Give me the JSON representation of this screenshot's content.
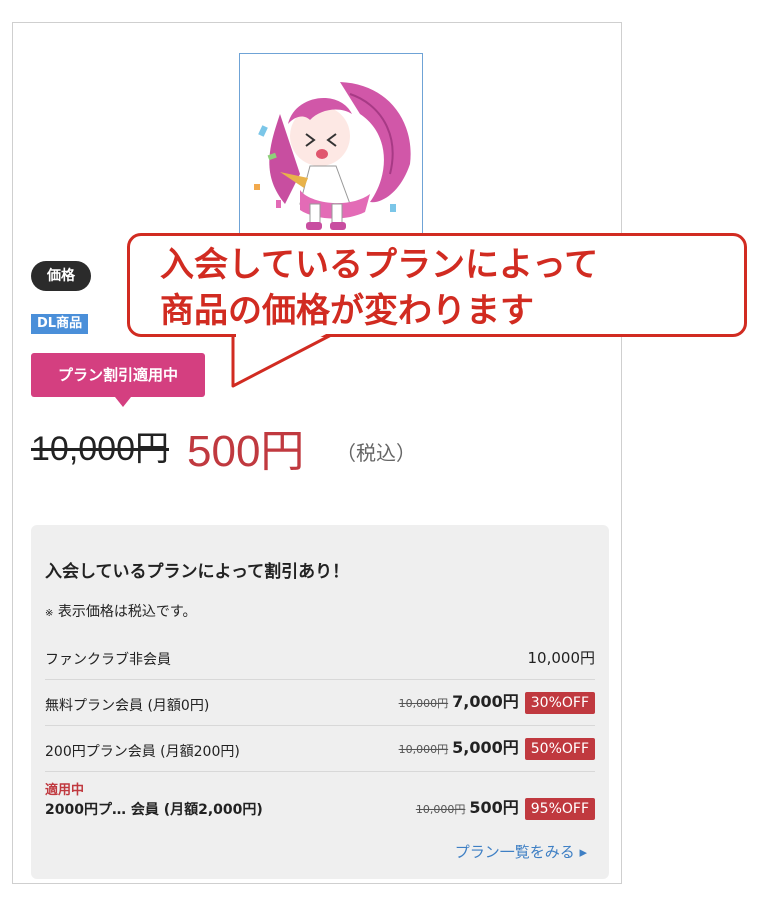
{
  "badges": {
    "price": "価格",
    "dl": "DL商品"
  },
  "plan_ribbon": "プラン割引適用中",
  "price": {
    "original": "10,000円",
    "discounted": "500円",
    "tax_note": "（税込）"
  },
  "callout": {
    "line1": "入会しているプランによって",
    "line2": "商品の価格が変わります"
  },
  "panel": {
    "title": "入会しているプランによって割引あり！",
    "note_mark": "※",
    "note": "表示価格は税込です。",
    "tiers": [
      {
        "name": "ファンクラブ非会員",
        "price": "10,000円"
      },
      {
        "name": "無料プラン会員 (月額0円)",
        "old": "10,000円",
        "new": "7,000円",
        "off": "30%OFF"
      },
      {
        "name": "200円プラン会員 (月額200円)",
        "old": "10,000円",
        "new": "5,000円",
        "off": "50%OFF"
      },
      {
        "active_label": "適用中",
        "name": "2000円プ… 会員 (月額2,000円)",
        "old": "10,000円",
        "new": "500円",
        "off": "95%OFF"
      }
    ],
    "more_link": "プラン一覧をみる ▸"
  },
  "colors": {
    "accent_red": "#c0393f",
    "ribbon_pink": "#d43f80",
    "callout_red": "#d12b21",
    "link_blue": "#3e7fc4"
  },
  "icons": {
    "thumbnail": "anime-character-image"
  }
}
